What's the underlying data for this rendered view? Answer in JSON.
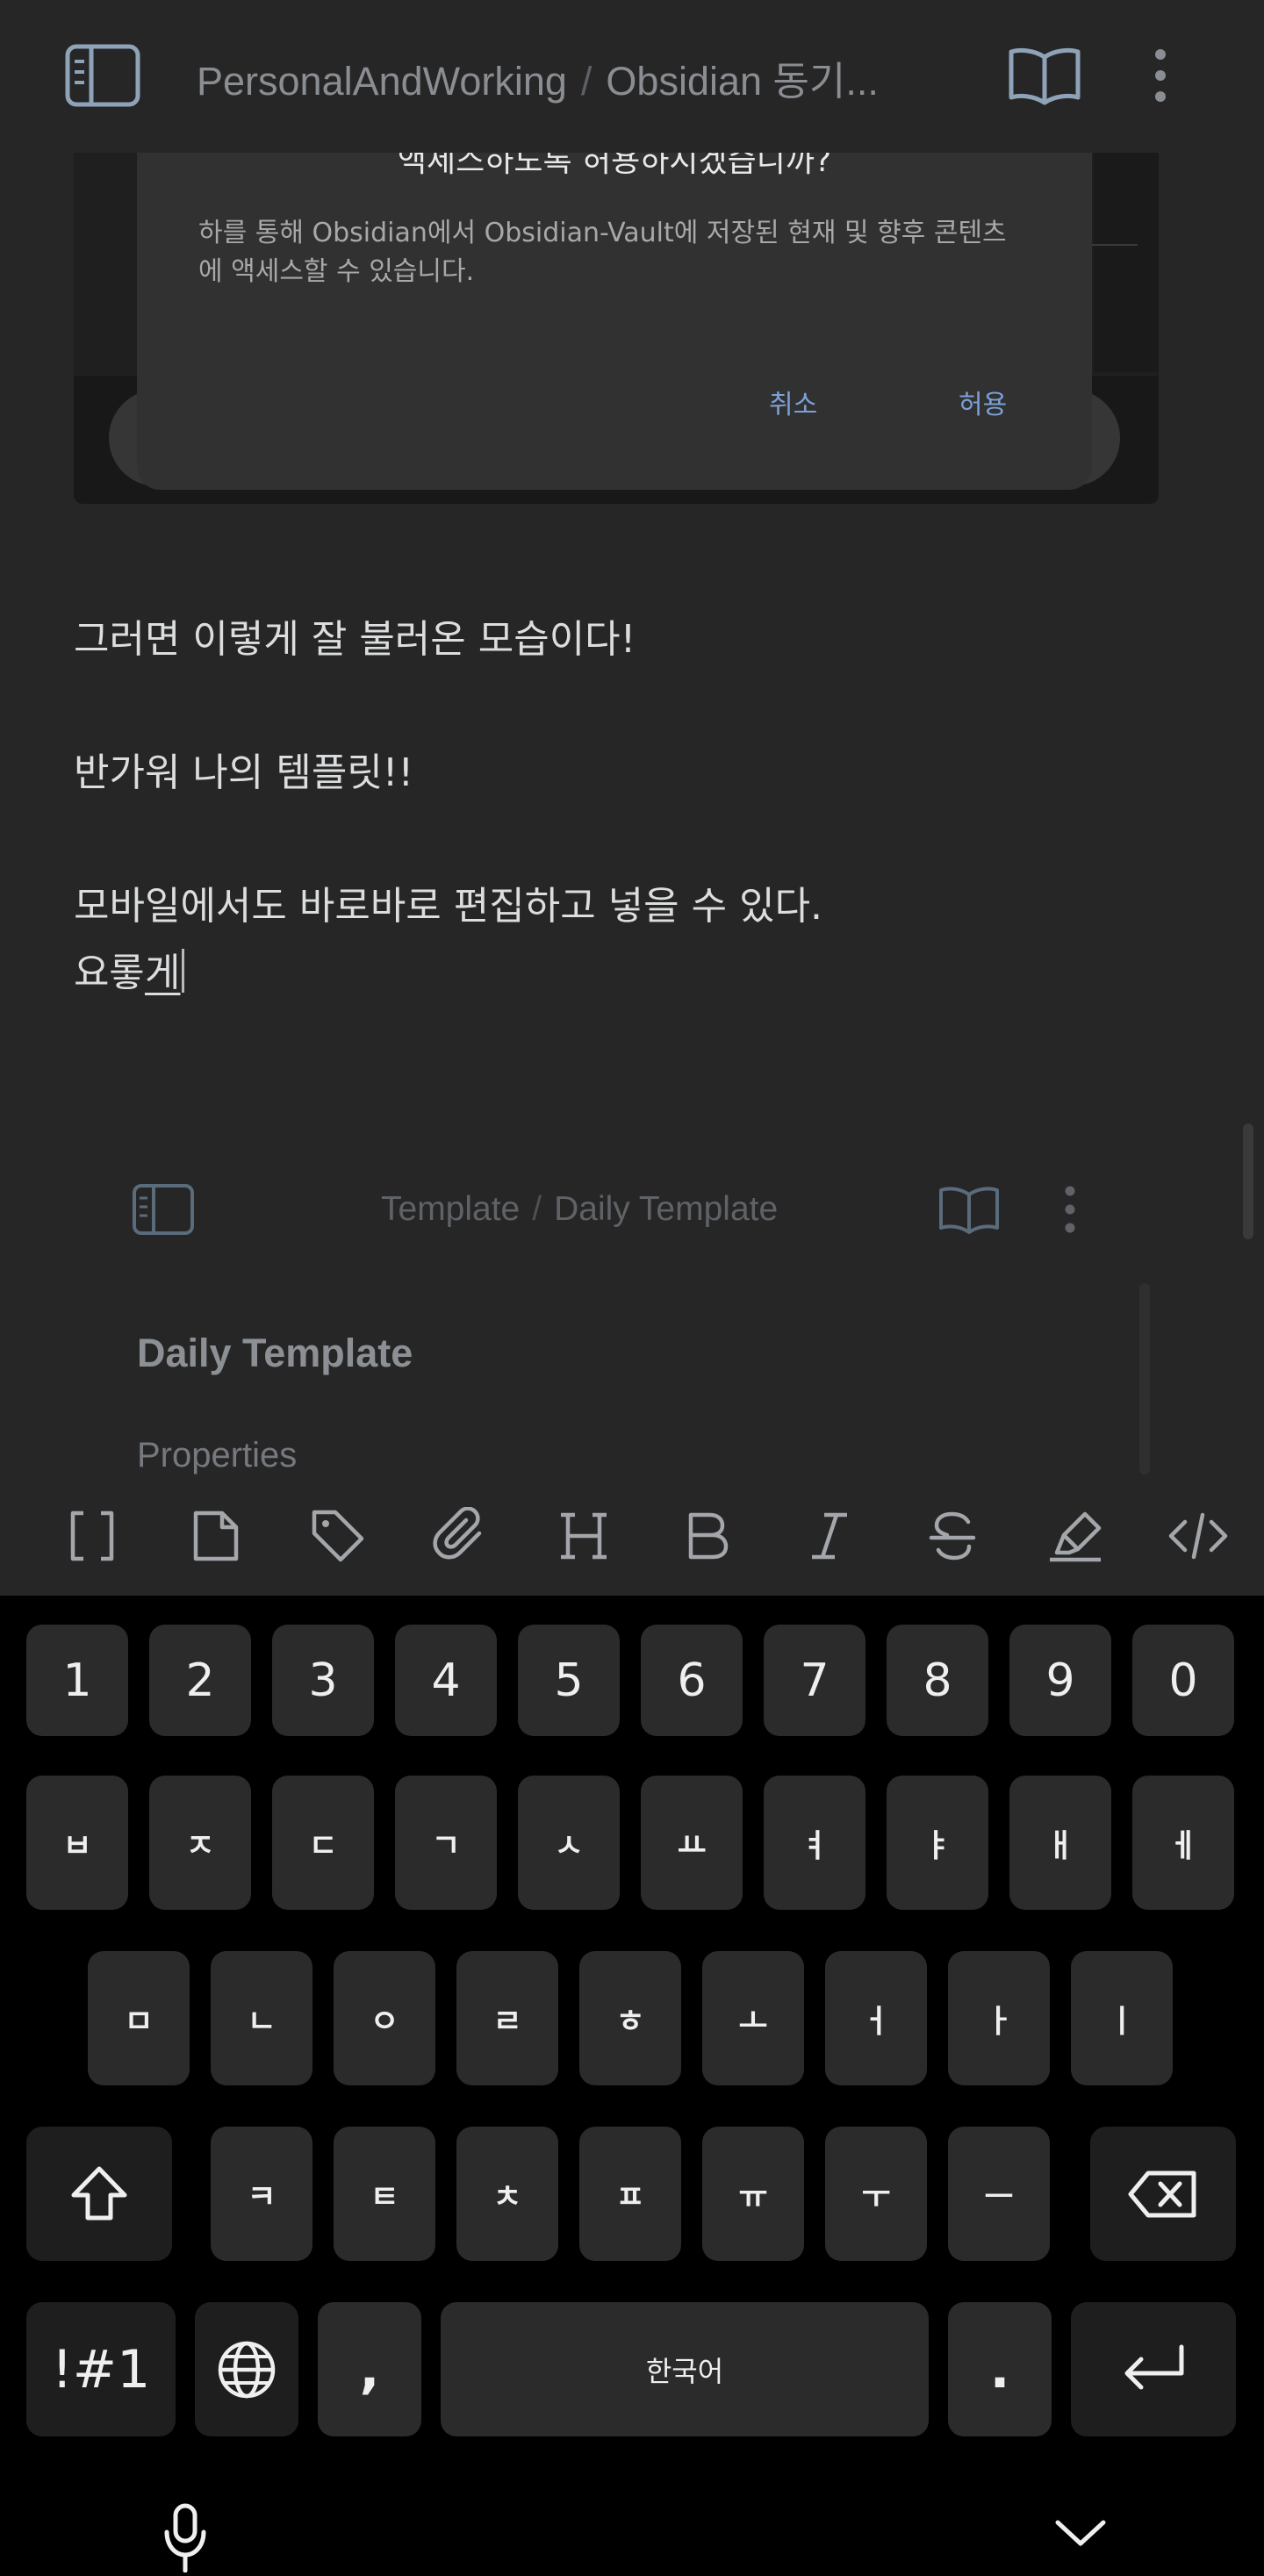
{
  "header": {
    "vault": "PersonalAndWorking",
    "separator": "/",
    "note": "Obsidian 동기...",
    "icons": [
      "sidebar-toggle-icon",
      "reading-view-icon",
      "more-options-icon"
    ]
  },
  "image": {
    "dialog_title": "액세스하도록 허용하시겠습니까?",
    "dialog_body": "하를 통해 Obsidian에서 Obsidian-Vault에 저장된 현재 및 향후 콘텐츠에 액세스할 수 있습니다.",
    "cancel": "취소",
    "allow": "허용"
  },
  "body": {
    "p1": "그러면 이렇게 잘 불러온 모습이다!",
    "p2": "반가워 나의 템플릿!!",
    "p3": "모바일에서도 바로바로 편집하고 넣을 수 있다.",
    "p4_prefix": "요롷",
    "p4_cursor": "게"
  },
  "embed": {
    "folder": "Template",
    "separator": "/",
    "file": "Daily Template",
    "title": "Daily Template",
    "properties": "Properties"
  },
  "toolbar": {
    "items": [
      "wikilink-icon",
      "file-icon",
      "tag-icon",
      "attachment-icon",
      "heading-icon",
      "bold-icon",
      "italic-icon",
      "strikethrough-icon",
      "highlight-icon",
      "code-icon"
    ]
  },
  "keyboard": {
    "numbers": [
      "1",
      "2",
      "3",
      "4",
      "5",
      "6",
      "7",
      "8",
      "9",
      "0"
    ],
    "row1": [
      "ㅂ",
      "ㅈ",
      "ㄷ",
      "ㄱ",
      "ㅅ",
      "ㅛ",
      "ㅕ",
      "ㅑ",
      "ㅐ",
      "ㅔ"
    ],
    "row2": [
      "ㅁ",
      "ㄴ",
      "ㅇ",
      "ㄹ",
      "ㅎ",
      "ㅗ",
      "ㅓ",
      "ㅏ",
      "ㅣ"
    ],
    "row3": [
      "ㅋ",
      "ㅌ",
      "ㅊ",
      "ㅍ",
      "ㅠ",
      "ㅜ",
      "ㅡ"
    ],
    "symbols": "!#1",
    "comma": ",",
    "space": "한국어",
    "period": ".",
    "colors": {
      "key": "#2b2b2b",
      "key_dark": "#1e1e1e",
      "background": "#000000"
    }
  }
}
